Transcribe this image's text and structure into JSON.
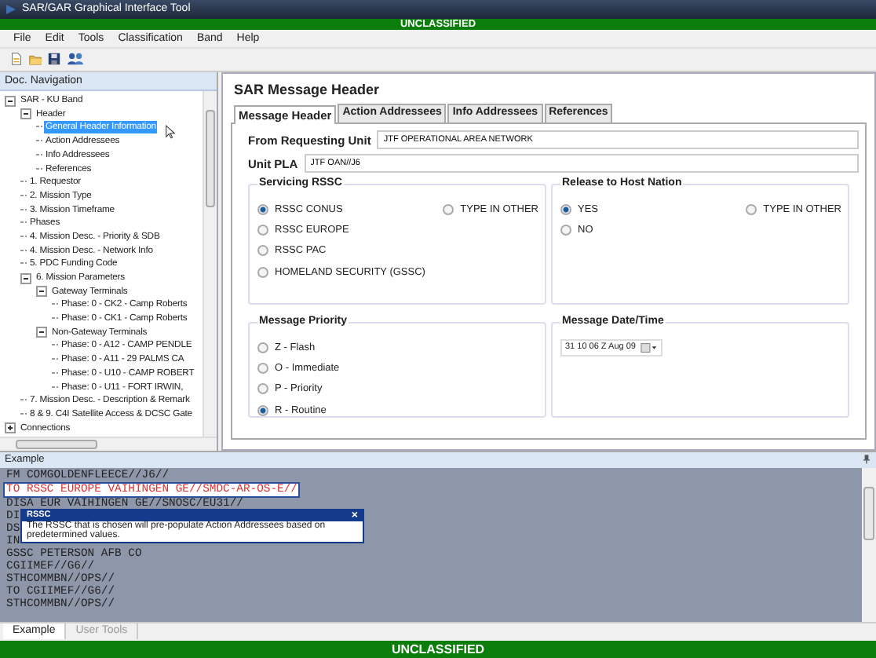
{
  "window": {
    "title": "SAR/GAR Graphical Interface Tool"
  },
  "classification_top": "UNCLASSIFIED",
  "menu": [
    "File",
    "Edit",
    "Tools",
    "Classification",
    "Band",
    "Help"
  ],
  "navigation": {
    "title": "Doc. Navigation",
    "tree": [
      {
        "label": "SAR - KU Band",
        "expanded": true,
        "selected": false,
        "children": [
          {
            "label": "Header",
            "expanded": true,
            "selected": false,
            "children": [
              {
                "label": "General Header Information",
                "selected": true
              },
              {
                "label": "Action Addressees",
                "selected": false
              },
              {
                "label": "Info Addressees",
                "selected": false
              },
              {
                "label": "References",
                "selected": false
              }
            ]
          },
          {
            "label": "1. Requestor",
            "selected": false
          },
          {
            "label": "2. Mission Type",
            "selected": false
          },
          {
            "label": "3. Mission Timeframe",
            "selected": false
          },
          {
            "label": "Phases",
            "selected": false
          },
          {
            "label": "4. Mission Desc. - Priority & SDB",
            "selected": false
          },
          {
            "label": "4. Mission Desc. - Network Info",
            "selected": false
          },
          {
            "label": "5. PDC Funding Code",
            "selected": false
          },
          {
            "label": "6. Mission Parameters",
            "expanded": true,
            "selected": false,
            "children": [
              {
                "label": "Gateway Terminals",
                "expanded": true,
                "selected": false,
                "children": [
                  {
                    "label": "Phase: 0  - CK2 - Camp Roberts",
                    "selected": false
                  },
                  {
                    "label": "Phase: 0  - CK1 - Camp Roberts",
                    "selected": false
                  }
                ]
              },
              {
                "label": "Non-Gateway Terminals",
                "expanded": true,
                "selected": false,
                "children": [
                  {
                    "label": "Phase: 0 - A12 - CAMP PENDLE",
                    "selected": false
                  },
                  {
                    "label": "Phase: 0 - A11 - 29 PALMS CA",
                    "selected": false
                  },
                  {
                    "label": "Phase: 0 - U10 - CAMP ROBERT",
                    "selected": false
                  },
                  {
                    "label": "Phase: 0 - U11 - FORT IRWIN,",
                    "selected": false
                  }
                ]
              }
            ]
          },
          {
            "label": "7. Mission Desc. - Description & Remark",
            "selected": false
          },
          {
            "label": "8 & 9. C4I Satellite Access & DCSC Gate",
            "selected": false
          }
        ]
      },
      {
        "label": "Connections",
        "expanded": false,
        "selected": false
      }
    ]
  },
  "panel": {
    "title": "SAR Message Header",
    "tabs": [
      {
        "label": "Message Header",
        "selected": true
      },
      {
        "label": "Action Addressees",
        "selected": false
      },
      {
        "label": "Info Addressees",
        "selected": false
      },
      {
        "label": "References",
        "selected": false
      }
    ],
    "fields": [
      {
        "label": "From Requesting Unit",
        "value": "JTF OPERATIONAL AREA NETWORK"
      },
      {
        "label": "Unit PLA",
        "value": "JTF OAN//J6"
      }
    ],
    "groups": [
      {
        "kind": "radio",
        "title": "Servicing RSSC",
        "options": [
          {
            "label": "RSSC CONUS",
            "selected": true
          },
          {
            "label": "RSSC EUROPE",
            "selected": false
          },
          {
            "label": "RSSC PAC",
            "selected": false
          },
          {
            "label": "HOMELAND SECURITY (GSSC)",
            "selected": false
          }
        ],
        "other": {
          "label": "TYPE IN OTHER",
          "selected": false
        }
      },
      {
        "kind": "radio",
        "title": "Release to Host Nation",
        "options": [
          {
            "label": "YES",
            "selected": true
          },
          {
            "label": "NO",
            "selected": false
          }
        ],
        "other": {
          "label": "TYPE IN OTHER",
          "selected": false
        }
      },
      {
        "kind": "radio",
        "title": "Message Priority",
        "options": [
          {
            "label": "Z - Flash",
            "selected": false
          },
          {
            "label": "O - Immediate",
            "selected": false
          },
          {
            "label": "P - Priority",
            "selected": false
          },
          {
            "label": "R - Routine",
            "selected": true
          }
        ]
      },
      {
        "kind": "date",
        "title": "Message Date/Time",
        "value": "31 10 06 Z Aug 09"
      }
    ]
  },
  "example": {
    "title": "Example",
    "lines": [
      {
        "text": "FM COMGOLDENFLEECE//J6//",
        "highlighted": false
      },
      {
        "text": "TO RSSC EUROPE VAIHINGEN GE//SMDC-AR-OS-E//",
        "highlighted": true
      },
      {
        "text": "DISA EUR VAIHINGEN GE//SNOSC/EU31//",
        "highlighted": false
      },
      {
        "text": "DI",
        "highlighted": false
      },
      {
        "text": "DS",
        "highlighted": false
      },
      {
        "text": "IN",
        "highlighted": false
      },
      {
        "text": "GSSC PETERSON AFB CO",
        "highlighted": false
      },
      {
        "text": "CGIIMEF//G6//",
        "highlighted": false
      },
      {
        "text": "STHCOMMBN//OPS//",
        "highlighted": false
      },
      {
        "text": "TO CGIIMEF//G6//",
        "highlighted": false
      },
      {
        "text": "STHCOMMBN//OPS//",
        "highlighted": false
      }
    ],
    "tooltip": {
      "title": "RSSC",
      "close": "×",
      "text": "The RSSC that is chosen will pre-populate Action Addressees based on predetermined values."
    },
    "tabs": [
      {
        "label": "Example",
        "selected": true
      },
      {
        "label": "User Tools",
        "selected": false
      }
    ]
  },
  "classification_bottom": "UNCLASSIFIED"
}
